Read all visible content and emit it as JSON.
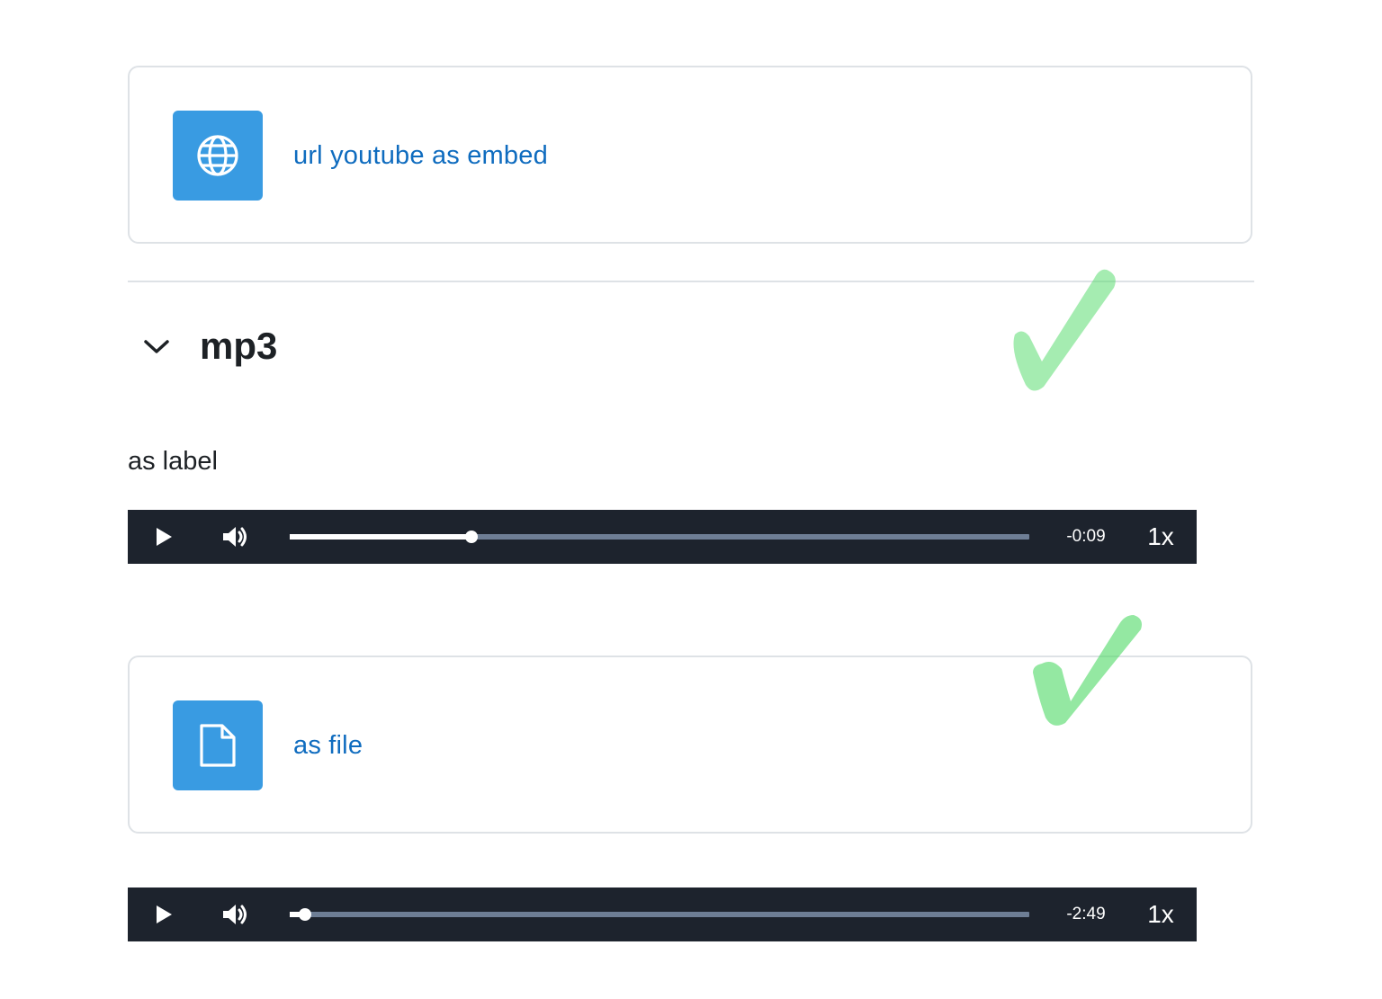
{
  "url_activity": {
    "icon": "globe-icon",
    "link_text": "url youtube as embed",
    "icon_color": "#399be2",
    "link_color": "#0f6cbf"
  },
  "section": {
    "toggle_icon": "chevron-down-icon",
    "title": "mp3"
  },
  "label": {
    "text": "as label"
  },
  "player_label": {
    "play_icon": "play-icon",
    "volume_icon": "volume-icon",
    "progress_fraction": 0.246,
    "time_remaining": "-0:09",
    "speed": "1x"
  },
  "file_activity": {
    "icon": "file-icon",
    "link_text": "as file",
    "icon_color": "#399be2",
    "link_color": "#0f6cbf"
  },
  "player_file": {
    "play_icon": "play-icon",
    "volume_icon": "volume-icon",
    "progress_fraction": 0.021,
    "time_remaining": "-2:49",
    "speed": "1x"
  },
  "annotations": {
    "check_icon": "green-checkmark-icon",
    "check_color": "#4cd964"
  }
}
